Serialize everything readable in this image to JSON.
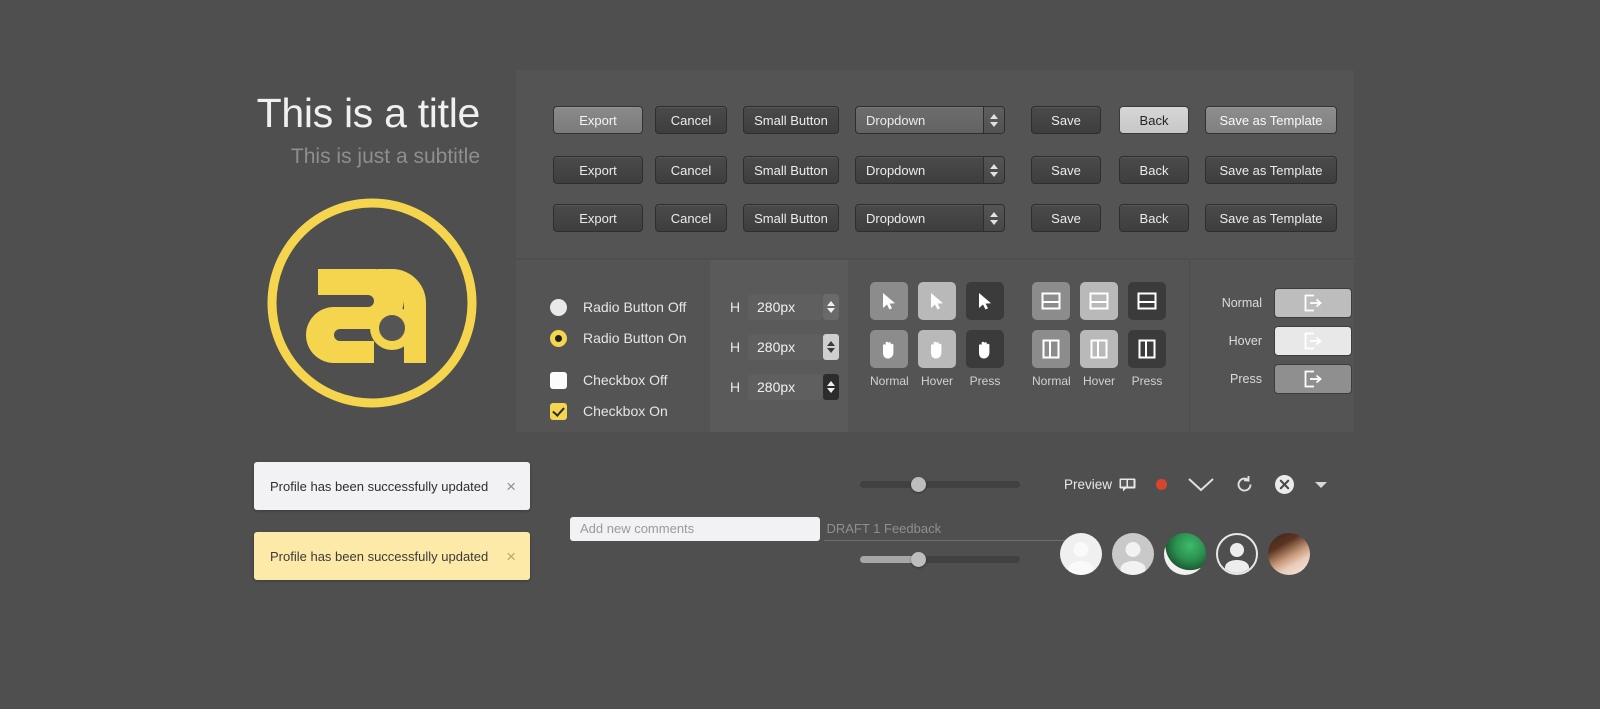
{
  "hero": {
    "title": "This is a title",
    "subtitle": "This is just a subtitle",
    "logo_name": "sa-logo",
    "logo_color": "#f5d54e"
  },
  "button_matrix": {
    "rows": [
      {
        "state": "hover",
        "export": "Export",
        "cancel": "Cancel",
        "small": "Small Button",
        "dropdown": "Dropdown",
        "save": "Save",
        "back": "Back",
        "template": "Save as Template"
      },
      {
        "state": "normal",
        "export": "Export",
        "cancel": "Cancel",
        "small": "Small Button",
        "dropdown": "Dropdown",
        "save": "Save",
        "back": "Back",
        "template": "Save as Template"
      },
      {
        "state": "press",
        "export": "Export",
        "cancel": "Cancel",
        "small": "Small Button",
        "dropdown": "Dropdown",
        "save": "Save",
        "back": "Back",
        "template": "Save as Template"
      }
    ]
  },
  "options": {
    "radio_off": "Radio Button Off",
    "radio_on": "Radio Button On",
    "checkbox_off": "Checkbox Off",
    "checkbox_on": "Checkbox On",
    "accent_color": "#f5d54e"
  },
  "steppers": {
    "label": "H",
    "rows": [
      {
        "value": "280px",
        "spinner_state": "normal"
      },
      {
        "value": "280px",
        "spinner_state": "hover"
      },
      {
        "value": "280px",
        "spinner_state": "press"
      }
    ]
  },
  "icon_grid": {
    "state_labels": [
      "Normal",
      "Hover",
      "Press"
    ],
    "row1_icon": "cursor-arrow-icon",
    "row2_icon": "hand-icon"
  },
  "icon_grid2": {
    "state_labels": [
      "Normal",
      "Hover",
      "Press"
    ],
    "row1_icon": "layout-horizontal-split-icon",
    "row2_icon": "layout-vertical-split-icon"
  },
  "export_states": {
    "rows": [
      {
        "label": "Normal",
        "icon": "export-icon"
      },
      {
        "label": "Hover",
        "icon": "export-icon"
      },
      {
        "label": "Press",
        "icon": "export-icon"
      }
    ]
  },
  "toasts": [
    {
      "message": "Profile has been successfully updated",
      "close": "×",
      "variant": "light"
    },
    {
      "message": "Profile has been successfully updated",
      "close": "×",
      "variant": "yellow"
    }
  ],
  "comments": {
    "new_placeholder": "Add new comments",
    "new_value": "",
    "draft_placeholder": "DRAFT 1 Feedback",
    "draft_value": ""
  },
  "sliders": [
    {
      "fill_percent": 0,
      "knob_percent": 36
    },
    {
      "fill_percent": 36,
      "knob_percent": 36
    }
  ],
  "preview_bar": {
    "label": "Preview",
    "label_icon": "comment-screen-icon",
    "record_dot": "record-dot",
    "record_color": "#d8452f",
    "chevron": "chevron-down-icon",
    "refresh": "refresh-icon",
    "close": "close-circle-icon",
    "caret": "caret-down-icon"
  },
  "avatars": [
    {
      "type": "blank",
      "name": "avatar-blank"
    },
    {
      "type": "silhouette-gray",
      "name": "avatar-silhouette"
    },
    {
      "type": "photo-green",
      "name": "avatar-photo-1"
    },
    {
      "type": "silhouette-outline",
      "name": "avatar-outline"
    },
    {
      "type": "photo-person",
      "name": "avatar-photo-2"
    }
  ]
}
